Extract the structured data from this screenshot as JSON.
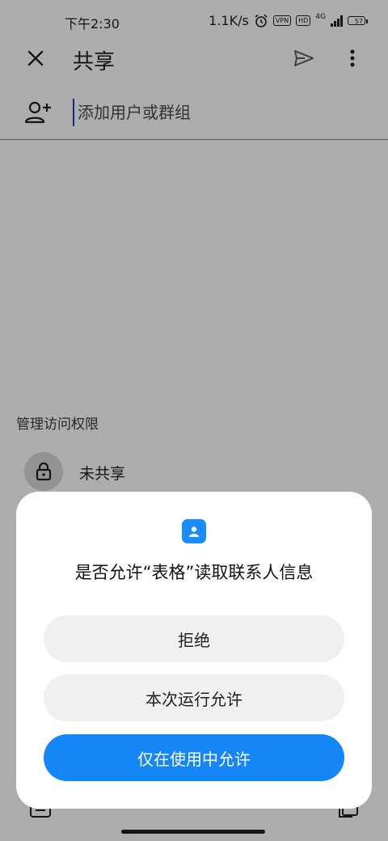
{
  "status_bar": {
    "time": "下午2:30",
    "network_speed": "1.1K/s",
    "vpn_badge": "VPN",
    "hd_badge": "HD",
    "network_type": "4G",
    "battery_level": "57"
  },
  "app_bar": {
    "title": "共享"
  },
  "add_people": {
    "placeholder": "添加用户或群组"
  },
  "manage_access": {
    "label": "管理访问权限",
    "status": "未共享"
  },
  "dialog": {
    "title": "是否允许“表格”读取联系人信息",
    "deny_label": "拒绝",
    "allow_once_label": "本次运行允许",
    "allow_while_using_label": "仅在使用中允许",
    "accent_color": "#1486f6"
  }
}
